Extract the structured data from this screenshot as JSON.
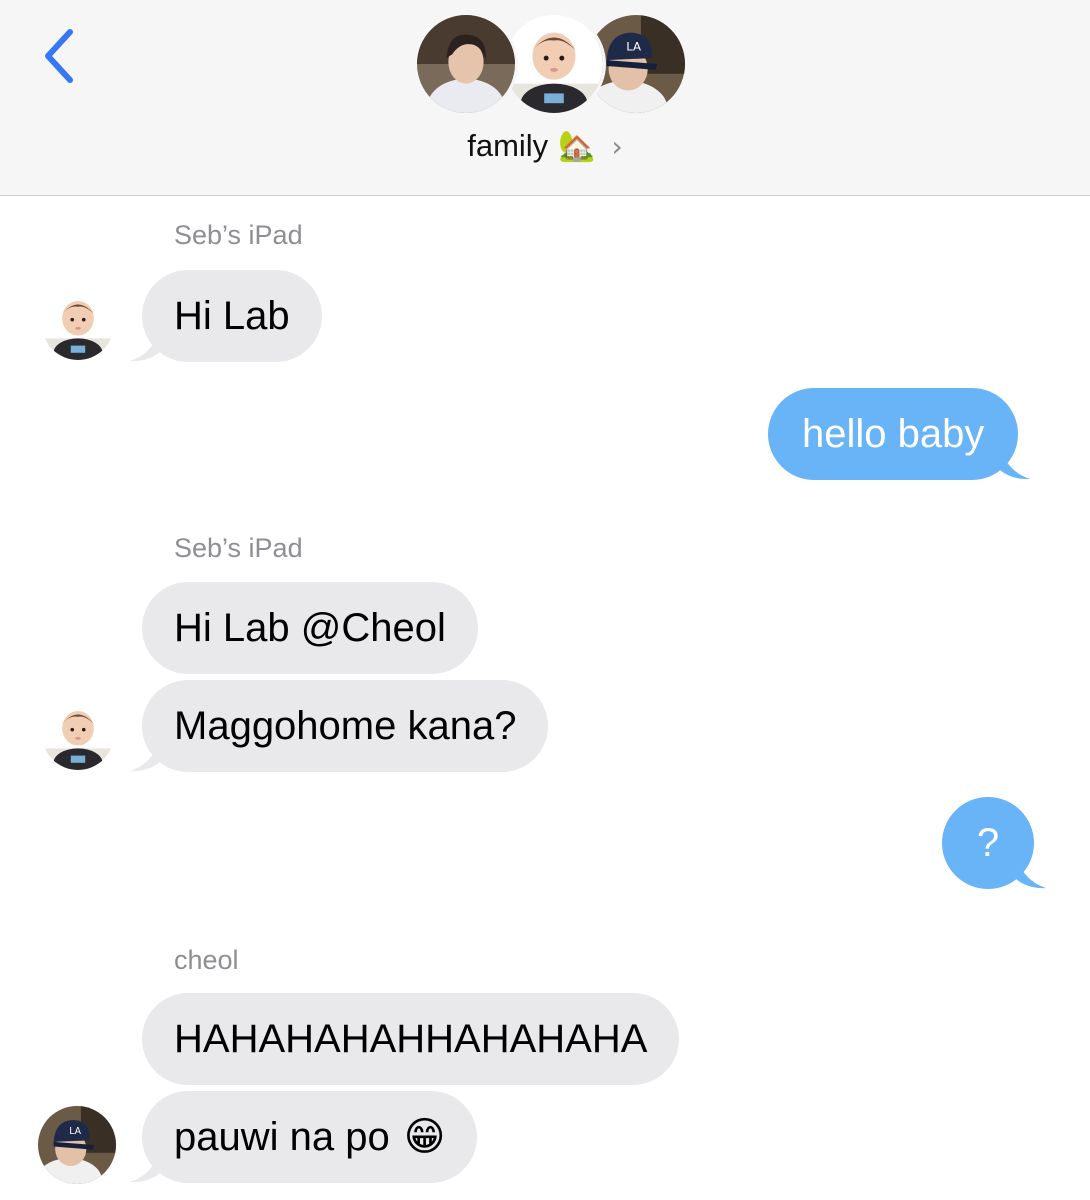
{
  "header": {
    "group_name": "family",
    "group_emoji": "🏡",
    "chevron": "›",
    "avatars": [
      "person-avatar",
      "baby-avatar",
      "cap-avatar"
    ]
  },
  "messages": [
    {
      "sender": "Seb’s iPad",
      "direction": "incoming",
      "text": "Hi Lab",
      "avatar": "baby-avatar"
    },
    {
      "direction": "outgoing",
      "text": "hello baby"
    },
    {
      "sender": "Seb’s iPad",
      "direction": "incoming",
      "text": "Hi Lab @Cheol"
    },
    {
      "direction": "incoming",
      "text": "Maggohome kana?",
      "avatar": "baby-avatar"
    },
    {
      "direction": "outgoing",
      "text": "?"
    },
    {
      "sender": "cheol",
      "direction": "incoming",
      "text": "HAHAHAHAHHAHAHAHA"
    },
    {
      "direction": "incoming",
      "text": "pauwi na po",
      "emoji": "😁",
      "avatar": "cap-avatar"
    }
  ],
  "colors": {
    "accent": "#3478f6",
    "incoming_bubble": "#e9e9eb",
    "outgoing_bubble": "#69b3f7",
    "header_bg": "#f6f6f7",
    "sender_label": "#8e8e93"
  }
}
